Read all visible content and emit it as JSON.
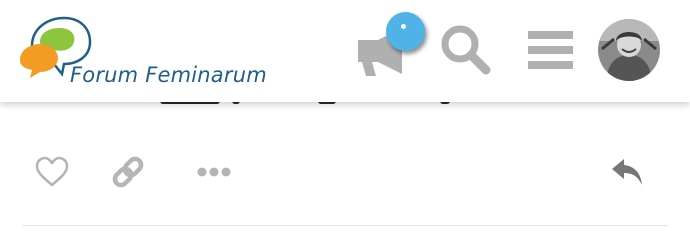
{
  "site": {
    "name": "Forum Feminarum",
    "logo_colors": {
      "blue": "#1f5f8a",
      "orange": "#f39c24",
      "green": "#8cc63f"
    }
  },
  "header": {
    "notifications": {
      "icon": "megaphone-icon",
      "badge_color": "#4fb3e8"
    },
    "search": {
      "icon": "search-icon"
    },
    "menu": {
      "icon": "hamburger-menu-icon"
    },
    "user": {
      "icon": "avatar"
    }
  },
  "post_controls": {
    "like": {
      "icon": "heart-icon"
    },
    "share": {
      "icon": "link-icon"
    },
    "more": {
      "icon": "more-dots-icon"
    },
    "reply": {
      "icon": "reply-icon"
    }
  },
  "colors": {
    "icon_gray": "#b5b5b5",
    "reply_gray": "#777777"
  }
}
